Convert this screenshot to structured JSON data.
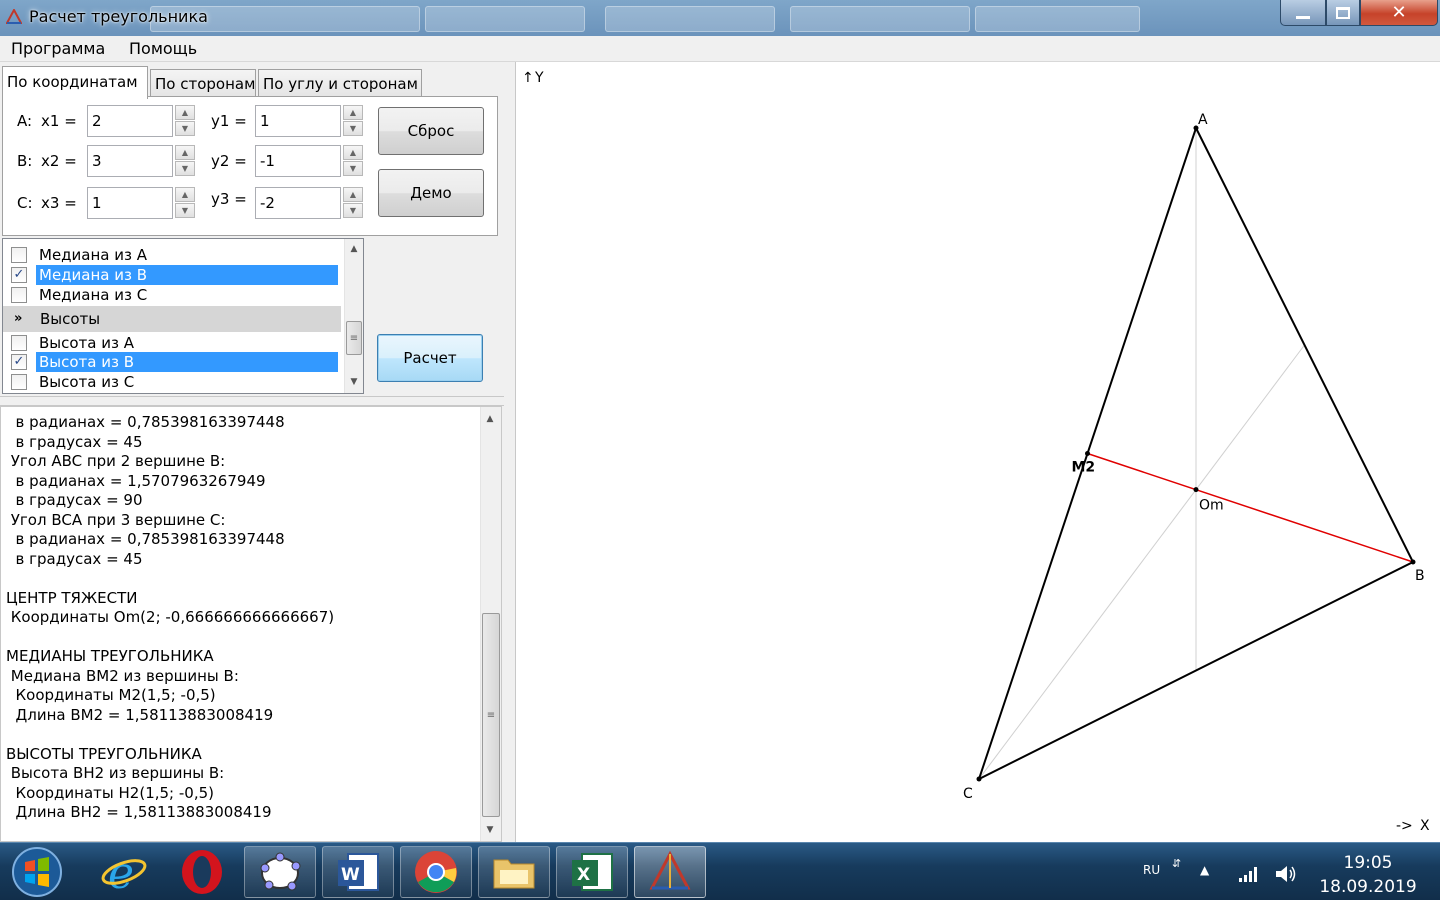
{
  "window": {
    "title": "Расчет треугольника"
  },
  "menu": {
    "items": [
      "Программа",
      "Помощь"
    ]
  },
  "tabs": [
    "По координатам",
    "По сторонам",
    "По углу и сторонам"
  ],
  "inputs": {
    "a_label": "A:",
    "x1_label": "x1 =",
    "x1": "2",
    "y1_label": "y1 =",
    "y1": "1",
    "b_label": "B:",
    "x2_label": "x2 =",
    "x2": "3",
    "y2_label": "y2 =",
    "y2": "-1",
    "c_label": "C:",
    "x3_label": "x3 =",
    "x3": "1",
    "y3_label": "y3 =",
    "y3": "-2"
  },
  "buttons": {
    "reset": "Сброс",
    "demo": "Демо",
    "calc": "Расчет"
  },
  "options": {
    "items": [
      {
        "label": "Медиана из A",
        "checked": false,
        "selected": false
      },
      {
        "label": "Медиана из B",
        "checked": true,
        "selected": true
      },
      {
        "label": "Медиана из C",
        "checked": false,
        "selected": false
      }
    ],
    "group": "Высоты",
    "group_items": [
      {
        "label": "Высота из A",
        "checked": false,
        "selected": false
      },
      {
        "label": "Высота из B",
        "checked": true,
        "selected": true
      },
      {
        "label": "Высота из C",
        "checked": false,
        "selected": false
      }
    ]
  },
  "output": {
    "lines": [
      "  в радианах = 0,785398163397448",
      "  в градусах = 45",
      " Угол ABC при 2 вершине B:",
      "  в радианах = 1,5707963267949",
      "  в градусах = 90",
      " Угол BCA при 3 вершине C:",
      "  в радианах = 0,785398163397448",
      "  в градусах = 45",
      "",
      "ЦЕНТР ТЯЖЕСТИ",
      " Координаты Om(2; -0,666666666666667)",
      "",
      "МЕДИАНЫ ТРЕУГОЛЬНИКА",
      " Медиана BM2 из вершины B:",
      "  Координаты M2(1,5; -0,5)",
      "  Длина BM2 = 1,58113883008419",
      "",
      "ВЫСОТЫ ТРЕУГОЛЬНИКА",
      " Высота BH2 из вершины B:",
      "  Координаты H2(1,5; -0,5)",
      "  Длина BH2 = 1,58113883008419"
    ]
  },
  "plot": {
    "y_axis_label": "Y",
    "x_axis_label": "X",
    "vertex_labels": [
      "A",
      "B",
      "C"
    ],
    "point_labels": [
      "M2",
      "Om"
    ],
    "triangle_color": "#000000",
    "median_color": "#e00000",
    "helper_color": "#d0d0d0"
  },
  "taskbar": {
    "apps": [
      "start-orb",
      "internet-explorer",
      "opera",
      "geogebra",
      "word",
      "chrome",
      "explorer",
      "excel",
      "triangle-app"
    ],
    "language": "RU",
    "time": "19:05",
    "date": "18.09.2019"
  }
}
